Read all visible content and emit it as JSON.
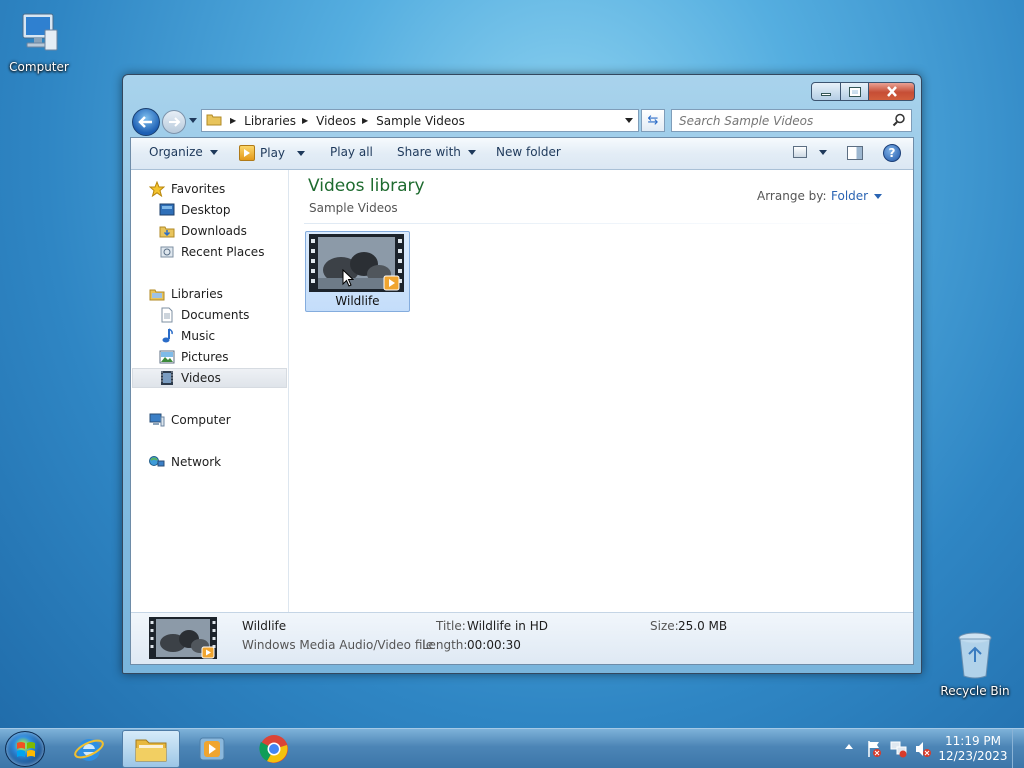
{
  "desktop": {
    "computer_label": "Computer",
    "recycle_label": "Recycle Bin"
  },
  "search": {
    "placeholder": "Search Sample Videos"
  },
  "address": {
    "segments": [
      "Libraries",
      "Videos",
      "Sample Videos"
    ]
  },
  "toolbar": {
    "organize": "Organize",
    "play": "Play",
    "play_all": "Play all",
    "share_with": "Share with",
    "new_folder": "New folder"
  },
  "nav": {
    "favorites": "Favorites",
    "desktop": "Desktop",
    "downloads": "Downloads",
    "recent_places": "Recent Places",
    "libraries": "Libraries",
    "documents": "Documents",
    "music": "Music",
    "pictures": "Pictures",
    "videos": "Videos",
    "computer": "Computer",
    "network": "Network"
  },
  "content": {
    "title": "Videos library",
    "subtitle": "Sample Videos",
    "arrange_label": "Arrange by:",
    "arrange_value": "Folder",
    "file_name": "Wildlife"
  },
  "details": {
    "name": "Wildlife",
    "type": "Windows Media Audio/Video file",
    "title_label": "Title:",
    "title_value": "Wildlife in HD",
    "length_label": "Length:",
    "length_value": "00:00:30",
    "size_label": "Size:",
    "size_value": "25.0 MB"
  },
  "taskbar": {
    "time": "11:19 PM",
    "date": "12/23/2023"
  },
  "colors": {
    "library_title": "#1e6b2f",
    "link": "#2a64b3",
    "selection": "#c4ddfa"
  }
}
